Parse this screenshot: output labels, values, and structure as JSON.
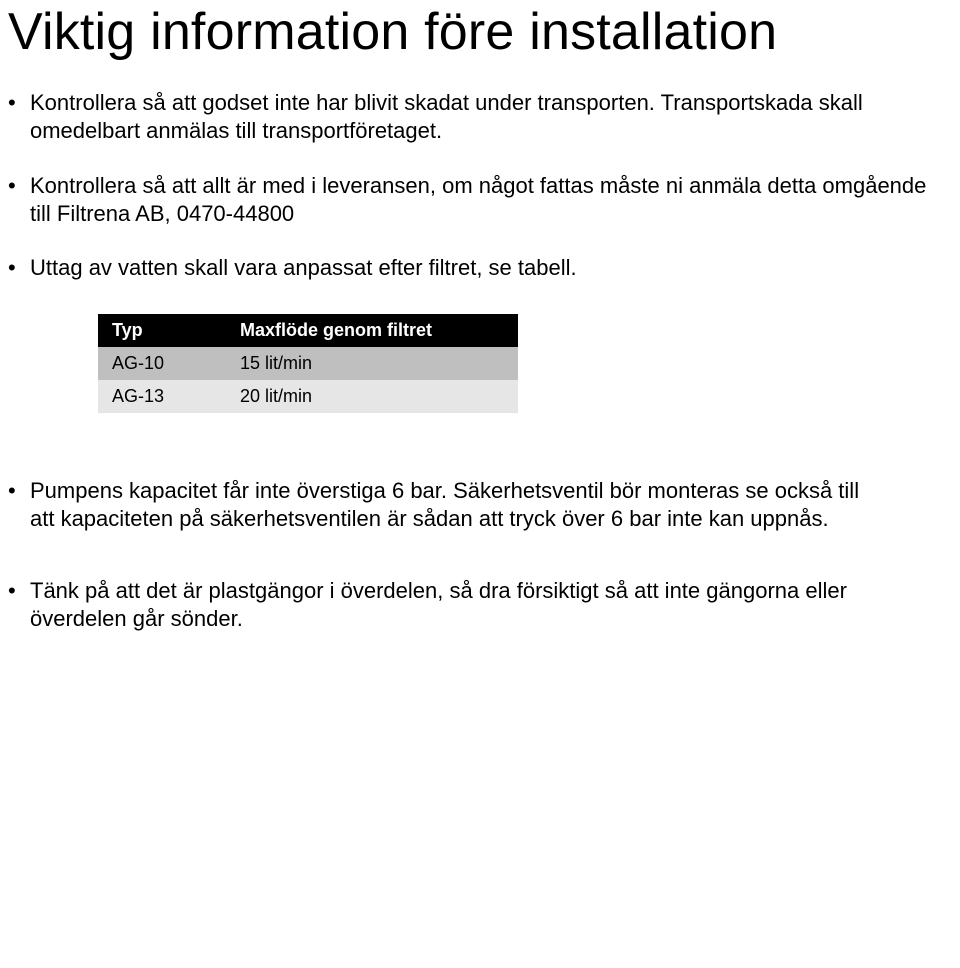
{
  "title": "Viktig information före installation",
  "bullets_top": [
    "Kontrollera så att godset inte har blivit skadat under transporten. Transportskada skall omedelbart anmälas till transportföretaget.",
    "Kontrollera så att allt är med i leveransen, om något fattas måste ni anmäla detta omgående till Filtrena AB, 0470-44800",
    "Uttag av vatten skall vara anpassat efter filtret, se tabell."
  ],
  "table": {
    "headers": [
      "Typ",
      "Maxflöde genom filtret"
    ],
    "rows": [
      [
        "AG-10",
        "15 lit/min"
      ],
      [
        "AG-13",
        "20 lit/min"
      ]
    ]
  },
  "bullets_bottom": [
    "Pumpens kapacitet får inte överstiga 6 bar. Säkerhetsventil bör monteras se också till\natt kapaciteten på säkerhetsventilen är sådan att tryck över 6 bar inte kan uppnås.",
    "Tänk på att det är plastgängor i överdelen, så dra försiktigt så att inte gängorna eller överdelen går sönder."
  ],
  "bullet_char": "•"
}
